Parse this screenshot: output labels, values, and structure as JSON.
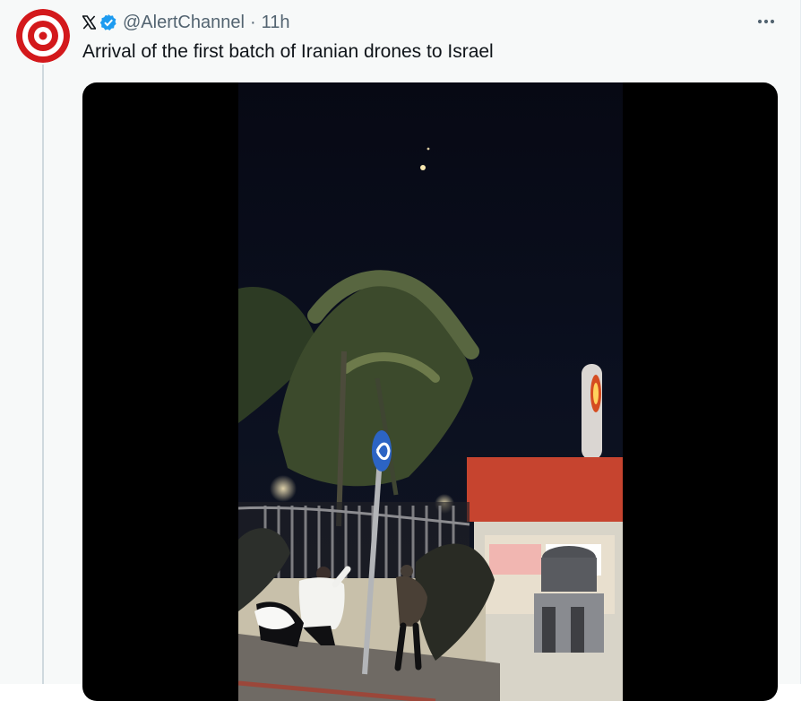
{
  "tweet": {
    "platform_icon": "x-logo-icon",
    "verified_icon": "verified-badge-icon",
    "handle": "@AlertChannel",
    "separator": "·",
    "time": "11h",
    "text": "Arrival of the first batch of Iranian drones to Israel",
    "more_icon": "more-options-icon",
    "avatar_icon": "target-avatar-icon",
    "media": {
      "type": "video",
      "description_icon": "night-street-video-thumbnail"
    }
  },
  "colors": {
    "background": "#f7f9f9",
    "text": "#0f1419",
    "secondary_text": "#536471",
    "verified_blue": "#1d9bf0",
    "avatar_red": "#d3191c",
    "thread_line": "#cfd9de"
  }
}
